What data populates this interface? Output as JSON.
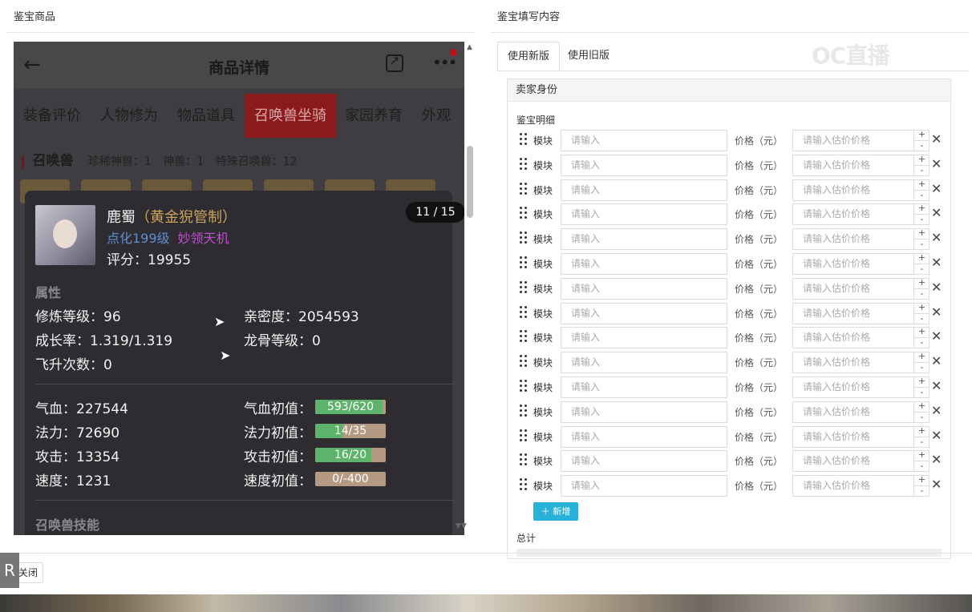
{
  "left_panel": {
    "title": "鉴宝商品"
  },
  "right_panel": {
    "title": "鉴宝填写内容"
  },
  "phone": {
    "header_title": "商品详情",
    "tabs": [
      "装备评价",
      "人物修为",
      "物品道具",
      "召唤兽坐骑",
      "家园养育",
      "外观"
    ],
    "active_tab": "召唤兽坐骑",
    "summon_header": "召唤兽",
    "summon_stats": [
      "珍稀神兽：1",
      "神兽：1",
      "特殊召唤兽：12"
    ],
    "pet": {
      "name": "鹿蜀",
      "type": "（黄金猊管制）",
      "tag1": "点化199级",
      "tag2": "妙领天机",
      "score": "评分：19955",
      "pager": "11 / 15"
    },
    "attr_title": "属性",
    "attrs_left": [
      "修炼等级：96",
      "成长率：1.319/1.319",
      "飞升次数：0"
    ],
    "attrs_right": [
      "亲密度：2054593",
      "龙骨等级：0"
    ],
    "stats_left": [
      "气血：227544",
      "法力：72690",
      "攻击：13354",
      "速度：1231"
    ],
    "stats_right_labels": [
      "气血初值：",
      "法力初值：",
      "攻击初值：",
      "速度初值："
    ],
    "bars": [
      {
        "text": "593/620",
        "fraction": 0.956
      },
      {
        "text": "14/35",
        "fraction": 0.4
      },
      {
        "text": "16/20",
        "fraction": 0.8
      },
      {
        "text": "0/-400",
        "fraction": 0
      }
    ],
    "skills_title": "召唤兽技能"
  },
  "form": {
    "tabs": [
      "使用新版",
      "使用旧版"
    ],
    "active_tab": "使用新版",
    "watermark": "OC直播",
    "section_title": "卖家身份",
    "detail_title": "鉴宝明细",
    "row_label": "模块",
    "row_placeholder": "请输入",
    "price_label": "价格（元）",
    "price_placeholder": "请输入估价价格",
    "step_plus": "+",
    "step_minus": "-",
    "delete_icon": "✕",
    "row_count": 15,
    "add_button": "＋ 新增",
    "total_label": "总计"
  },
  "footer": {
    "close_button": "关闭",
    "badge": "R"
  }
}
